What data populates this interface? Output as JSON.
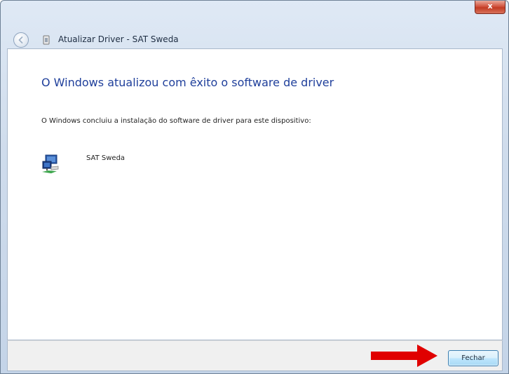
{
  "window": {
    "title": "Atualizar Driver - SAT Sweda",
    "close_symbol": "x"
  },
  "content": {
    "heading": "O Windows atualizou com êxito o software de driver",
    "description": "O Windows concluiu a instalação do software de driver para este dispositivo:",
    "device_name": "SAT Sweda",
    "device_icon": "network-device-icon"
  },
  "footer": {
    "close_button_label": "Fechar"
  },
  "colors": {
    "heading": "#1f3f9b",
    "arrow": "#e00000",
    "close_window": "#c23b23"
  }
}
